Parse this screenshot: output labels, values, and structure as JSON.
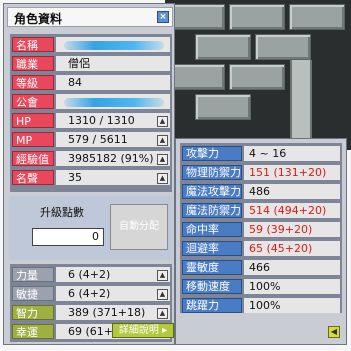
{
  "window": {
    "title": "角色資料",
    "close_icon": "×"
  },
  "profile": [
    {
      "label": "名稱",
      "value": "",
      "blurred": true
    },
    {
      "label": "職業",
      "value": "僧侶"
    },
    {
      "label": "等級",
      "value": "84"
    },
    {
      "label": "公會",
      "value": "",
      "blurred": true
    },
    {
      "label": "HP",
      "value": "1310 / 1310",
      "button": true
    },
    {
      "label": "MP",
      "value": "579 / 5611",
      "button": true
    },
    {
      "label": "經驗值",
      "value": "3985182 (91%)",
      "button": true
    },
    {
      "label": "名聲",
      "value": "35",
      "button": true
    }
  ],
  "ability_points": {
    "title": "升級點數",
    "value": "0",
    "auto_label": "自動分配"
  },
  "stats": [
    {
      "label": "力量",
      "value": "6 (4+2)"
    },
    {
      "label": "敏捷",
      "value": "6 (4+2)"
    },
    {
      "label": "智力",
      "value": "389 (371+18)"
    },
    {
      "label": "幸運",
      "value": "69 (61+8)"
    }
  ],
  "detail_button": "詳細說明 ▸",
  "details": [
    {
      "label": "攻擊力",
      "value": "4 ~ 16",
      "red": false
    },
    {
      "label": "物理防禦力",
      "value": "151 (131+20)",
      "red": true
    },
    {
      "label": "魔法攻擊力",
      "value": "486",
      "red": false
    },
    {
      "label": "魔法防禦力",
      "value": "514 (494+20)",
      "red": true
    },
    {
      "label": "命中率",
      "value": "59 (39+20)",
      "red": true
    },
    {
      "label": "迴避率",
      "value": "65 (45+20)",
      "red": true
    },
    {
      "label": "靈敏度",
      "value": "466",
      "red": false
    },
    {
      "label": "移動速度",
      "value": "100%",
      "red": false
    },
    {
      "label": "跳躍力",
      "value": "100%",
      "red": false
    }
  ],
  "colors": {
    "hp_label": "#e8475c",
    "detail_label": "#4a7cc5",
    "red_value": "#e01818",
    "stat_label": "#9fb043"
  }
}
